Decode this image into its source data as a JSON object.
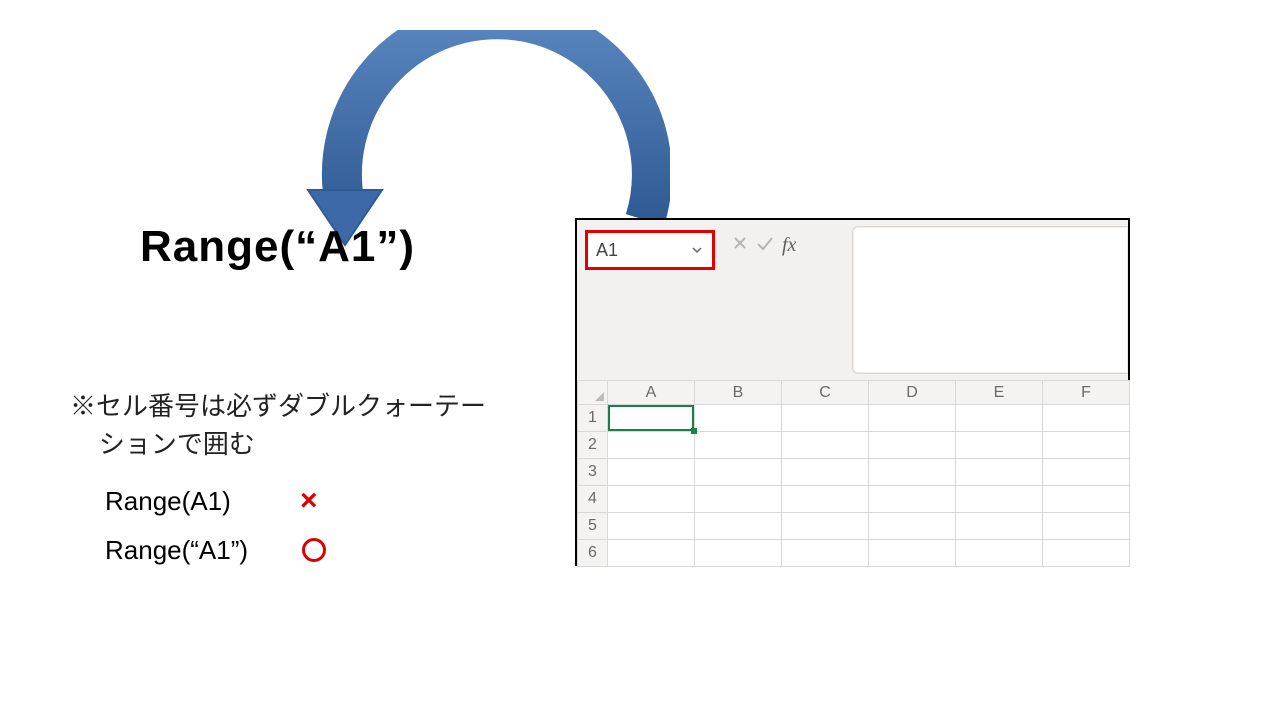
{
  "colors": {
    "arrow": "#3d6aa6",
    "arrow_dark": "#2f5a94",
    "highlight_border": "#e30000",
    "cell_select": "#1a7f4c"
  },
  "heading": "Range(“A1”)",
  "note_line1": "※セル番号は必ずダブルクォーテー",
  "note_line2": "ションで囲む",
  "examples": {
    "bad": {
      "code": "Range(A1)",
      "mark": "×"
    },
    "good": {
      "code": "Range(“A1”)",
      "mark": "○"
    }
  },
  "excel": {
    "namebox": "A1",
    "fx_label": "fx",
    "columns": [
      "A",
      "B",
      "C",
      "D",
      "E",
      "F"
    ],
    "rows": [
      "1",
      "2",
      "3",
      "4",
      "5",
      "6"
    ],
    "selected_cell": "A1"
  }
}
